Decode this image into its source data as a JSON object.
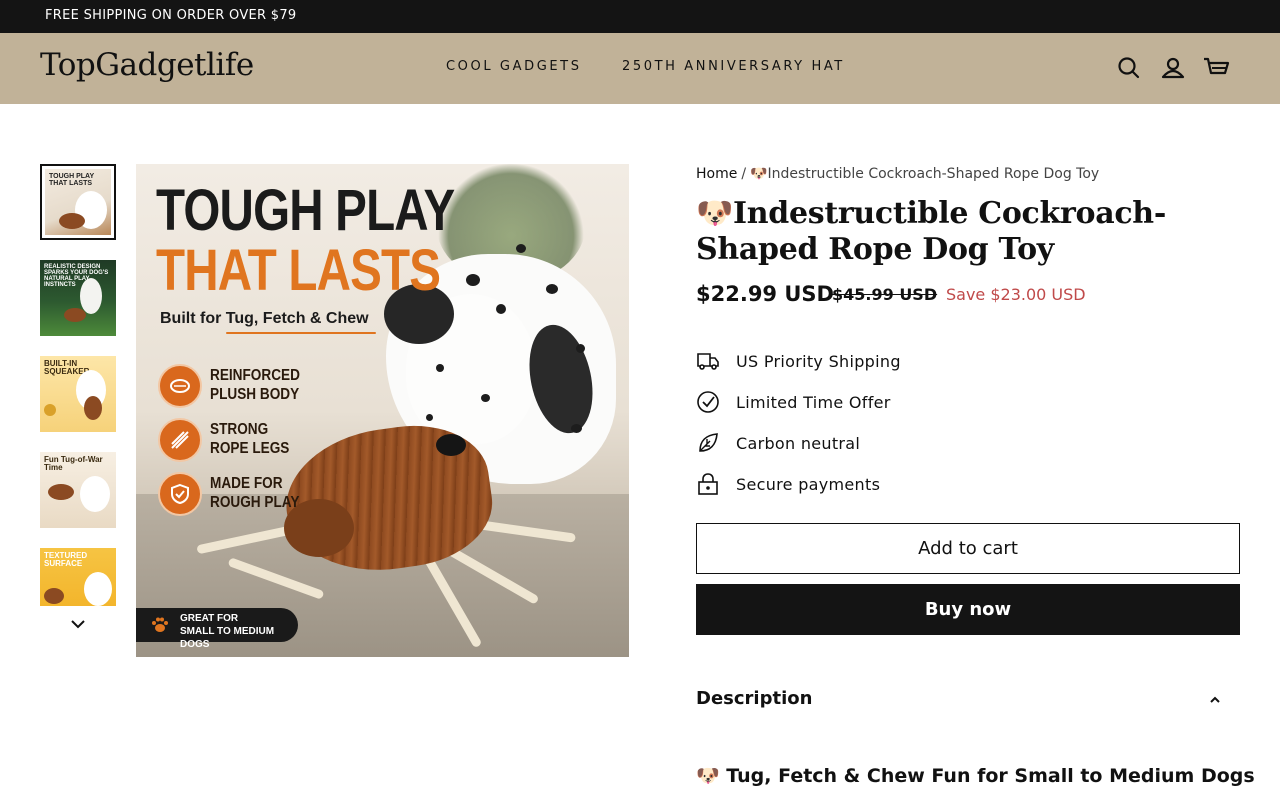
{
  "announcement": {
    "text": "FREE SHIPPING ON ORDER OVER $79"
  },
  "header": {
    "logo": "TopGadgetlife",
    "nav": [
      {
        "label": "COOL GADGETS"
      },
      {
        "label": "250TH ANNIVERSARY HAT"
      }
    ],
    "icons": [
      "search-icon",
      "account-icon",
      "cart-icon"
    ]
  },
  "gallery": {
    "thumbnails": [
      {
        "caption": "TOUGH PLAY THAT LASTS"
      },
      {
        "caption": "REALISTIC DESIGN SPARKS YOUR DOG'S NATURAL PLAY INSTINCTS"
      },
      {
        "caption": "BUILT-IN SQUEAKER"
      },
      {
        "caption": "Fun Tug-of-War Time"
      },
      {
        "caption": "TEXTURED SURFACE"
      }
    ],
    "main_image": {
      "headline_1": "TOUGH PLAY",
      "headline_2": "THAT LASTS",
      "subhead": "Built for Tug, Fetch & Chew",
      "features": [
        {
          "line1": "REINFORCED",
          "line2": "PLUSH BODY"
        },
        {
          "line1": "STRONG",
          "line2": "ROPE LEGS"
        },
        {
          "line1": "MADE FOR",
          "line2": "ROUGH PLAY"
        }
      ],
      "badge_line1": "GREAT FOR",
      "badge_line2": "SMALL TO MEDIUM DOGS"
    }
  },
  "product": {
    "breadcrumb_home": "Home",
    "breadcrumb_sep": "/",
    "breadcrumb_current": "🐶Indestructible Cockroach-Shaped Rope Dog Toy",
    "title": "🐶Indestructible Cockroach-Shaped Rope Dog Toy",
    "price": "$22.99 USD",
    "compare_price": "$45.99 USD",
    "save_text": "Save $23.00 USD",
    "perks": [
      {
        "label": "US Priority Shipping",
        "icon": "truck-icon"
      },
      {
        "label": "Limited Time Offer",
        "icon": "check-circle-icon"
      },
      {
        "label": "Carbon neutral",
        "icon": "leaf-icon"
      },
      {
        "label": "Secure payments",
        "icon": "lock-icon"
      }
    ],
    "add_to_cart": "Add to cart",
    "buy_now": "Buy now",
    "description_label": "Description",
    "description_subhead": "🐶 Tug, Fetch & Chew Fun for Small to Medium Dogs"
  },
  "colors": {
    "announcement_bg": "#141414",
    "header_bg": "#c1b298",
    "accent_orange": "#e0751f",
    "save_red": "#c04a4a",
    "button_dark": "#141414"
  }
}
